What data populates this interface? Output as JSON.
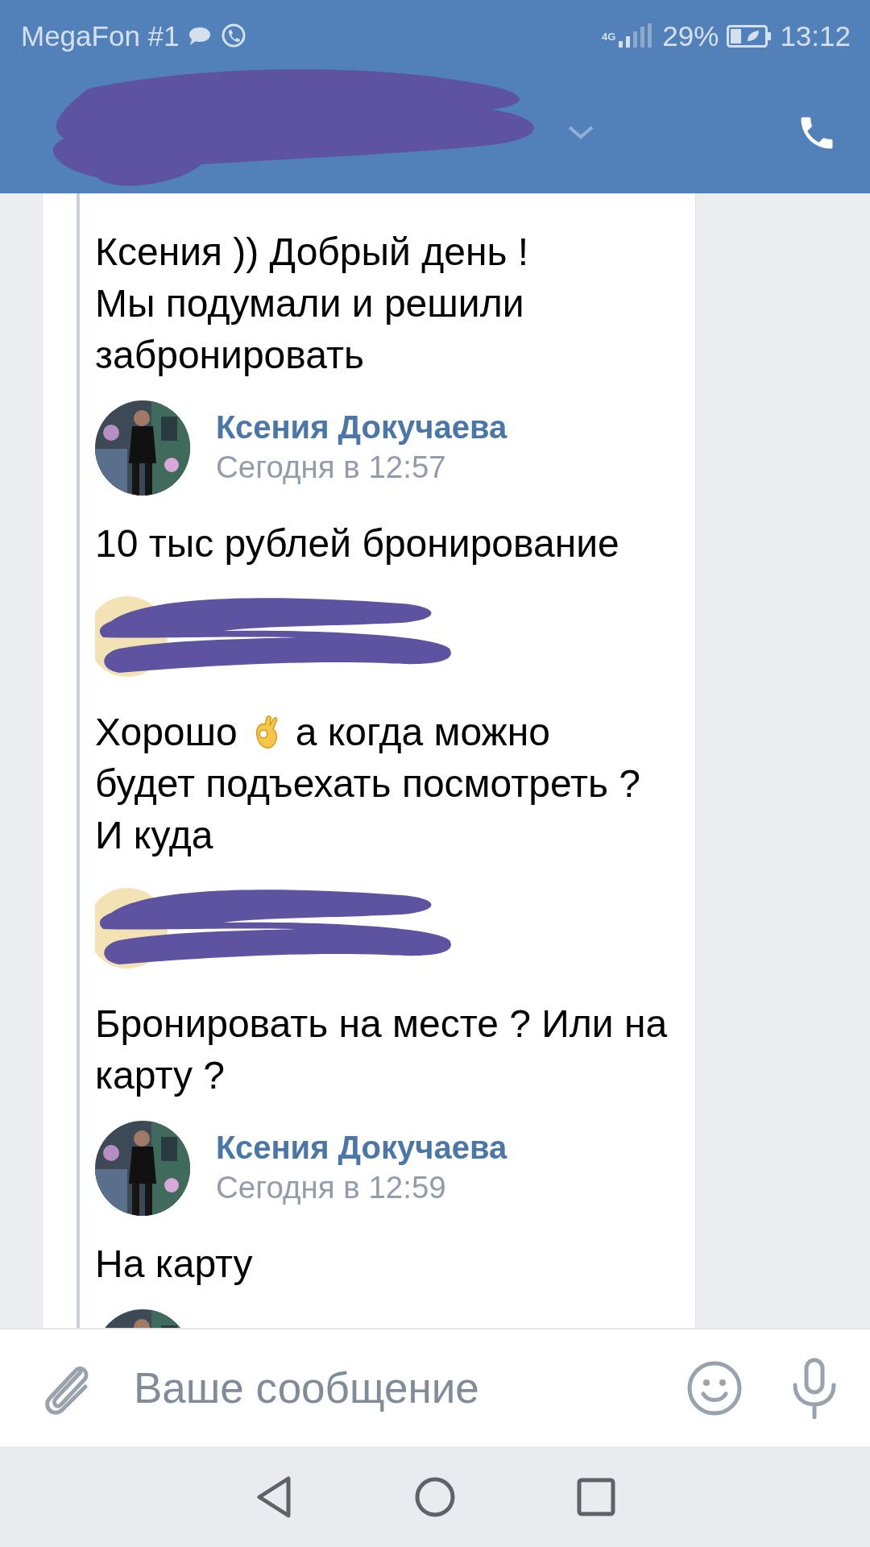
{
  "status_bar": {
    "carrier": "MegaFon #1",
    "network": "4G",
    "battery": "29%",
    "time": "13:12"
  },
  "messages": [
    {
      "kind": "text",
      "lines": [
        [
          {
            "kind": "text",
            "text": "Ксения )) Добрый день !"
          }
        ],
        [
          {
            "kind": "text",
            "text": "Мы подумали и решили"
          }
        ],
        [
          {
            "kind": "text",
            "text": "забронировать"
          }
        ]
      ]
    },
    {
      "kind": "author",
      "name": "Ксения Докучаева",
      "time": "Сегодня в 12:57"
    },
    {
      "kind": "text",
      "lines": [
        [
          {
            "kind": "text",
            "text": "10 тыс рублей  бронирование"
          }
        ]
      ]
    },
    {
      "kind": "redacted"
    },
    {
      "kind": "text",
      "lines": [
        [
          {
            "kind": "text",
            "text": "Хорошо"
          },
          {
            "kind": "emoji"
          },
          {
            "kind": "text",
            "text": "а когда можно"
          }
        ],
        [
          {
            "kind": "text",
            "text": "будет подъехать посмотреть ?"
          }
        ],
        [
          {
            "kind": "text",
            "text": "И куда"
          }
        ]
      ]
    },
    {
      "kind": "redacted"
    },
    {
      "kind": "text",
      "lines": [
        [
          {
            "kind": "text",
            "text": "Бронировать на месте ? Или на"
          }
        ],
        [
          {
            "kind": "text",
            "text": "карту ?"
          }
        ]
      ]
    },
    {
      "kind": "author",
      "name": "Ксения Докучаева",
      "time": "Сегодня в 12:59"
    },
    {
      "kind": "text",
      "lines": [
        [
          {
            "kind": "text",
            "text": "На карту"
          }
        ]
      ]
    },
    {
      "kind": "author"
    }
  ],
  "composer": {
    "placeholder": "Ваше сообщение"
  }
}
